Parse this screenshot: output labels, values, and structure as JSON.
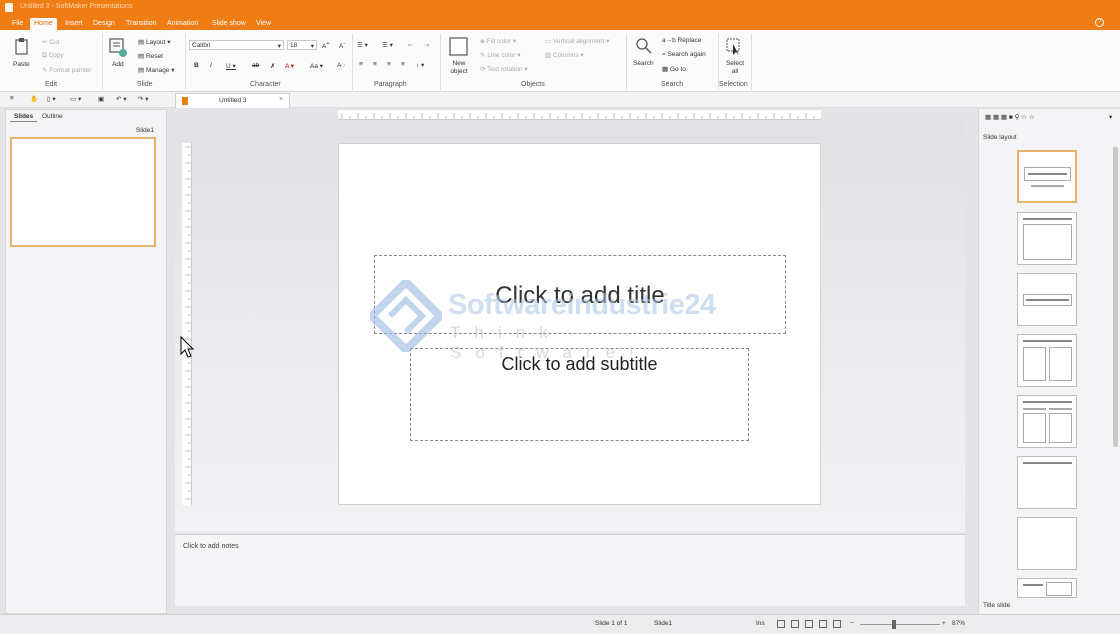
{
  "window": {
    "title": "Untitled 3 - SoftMaker Presentations"
  },
  "menu": {
    "tabs": [
      "File",
      "Home",
      "Insert",
      "Design",
      "Transition",
      "Animation",
      "Slide show",
      "View"
    ],
    "active": "Home"
  },
  "ribbon": {
    "edit": {
      "paste": "Paste",
      "cut": "Cut",
      "copy": "Copy",
      "format_painter": "Format painter",
      "label": "Edit"
    },
    "slide": {
      "add": "Add",
      "layout": "Layout",
      "reset": "Reset",
      "manage": "Manage",
      "label": "Slide"
    },
    "character": {
      "font": "Calibri",
      "size": "18",
      "label": "Character"
    },
    "paragraph": {
      "label": "Paragraph"
    },
    "objects": {
      "new_object": "New object",
      "fill_color": "Fill color",
      "line_color": "Line color",
      "text_rotation": "Text rotation",
      "vertical_alignment": "Vertical alignment",
      "columns": "Columns",
      "label": "Objects"
    },
    "search": {
      "search": "Search",
      "replace": "Replace",
      "search_again": "Search again",
      "go_to": "Go to",
      "label": "Search"
    },
    "selection": {
      "select_all": "Select all",
      "label": "Selection"
    }
  },
  "document_tab": {
    "title": "Untitled 3"
  },
  "left_panel": {
    "tabs": [
      "Slides",
      "Outline"
    ],
    "active": "Slides",
    "slide_label": "Slide1"
  },
  "slide": {
    "title_placeholder": "Click to add title",
    "subtitle_placeholder": "Click to add subtitle"
  },
  "watermark": {
    "name": "Softwareindustrie24",
    "slogan": "Think Software!"
  },
  "notes": {
    "placeholder": "Click to add notes"
  },
  "right_panel": {
    "title": "Slide layout",
    "footer": "Title slide"
  },
  "status": {
    "slide_count": "Slide 1 of 1",
    "slide_name": "Slide1",
    "mode": "Ins",
    "zoom": "87%"
  },
  "colors": {
    "accent": "#f07c14",
    "selection": "#e4b46e"
  }
}
